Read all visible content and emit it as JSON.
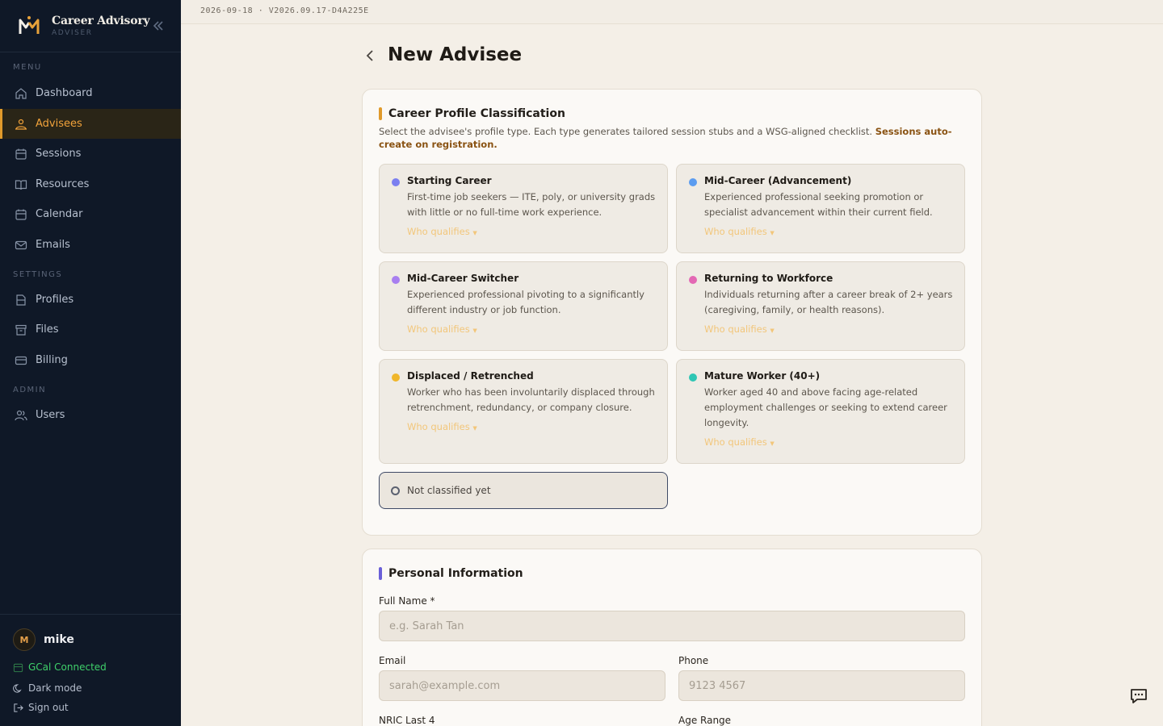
{
  "brand": {
    "title": "Career Advisory",
    "subtitle": "ADVISER"
  },
  "nav": {
    "menu_label": "MENU",
    "settings_label": "SETTINGS",
    "admin_label": "ADMIN",
    "items": [
      {
        "label": "Dashboard",
        "icon": "home-icon"
      },
      {
        "label": "Advisees",
        "icon": "users-icon",
        "active": true
      },
      {
        "label": "Sessions",
        "icon": "calendar-icon"
      },
      {
        "label": "Resources",
        "icon": "book-icon"
      },
      {
        "label": "Calendar",
        "icon": "calendar-icon"
      },
      {
        "label": "Emails",
        "icon": "mail-icon"
      },
      {
        "label": "Profiles",
        "icon": "file-icon"
      },
      {
        "label": "Files",
        "icon": "archive-icon"
      },
      {
        "label": "Billing",
        "icon": "credit-card-icon"
      },
      {
        "label": "Users",
        "icon": "people-icon"
      }
    ]
  },
  "footer": {
    "avatar_initial": "M",
    "user_name": "mike",
    "gcal": "GCal Connected",
    "dark_mode": "Dark mode",
    "sign_out": "Sign out"
  },
  "topbar": {
    "build": "2026-09-18 · V2026.09.17-D4A225E"
  },
  "page": {
    "title": "New Advisee"
  },
  "classification": {
    "title": "Career Profile Classification",
    "description": "Select the advisee's profile type. Each type generates tailored session stubs and a WSG-aligned checklist.",
    "description_bold": "Sessions auto-create on registration.",
    "who_qualifies": "Who qualifies",
    "options": [
      {
        "title": "Starting Career",
        "desc": "First-time job seekers — ITE, poly, or university grads with little or no full-time work experience.",
        "color": "#7b7ff0"
      },
      {
        "title": "Mid-Career (Advancement)",
        "desc": "Experienced professional seeking promotion or specialist advancement within their current field.",
        "color": "#5b9cf0"
      },
      {
        "title": "Mid-Career Switcher",
        "desc": "Experienced professional pivoting to a significantly different industry or job function.",
        "color": "#a87ff0"
      },
      {
        "title": "Returning to Workforce",
        "desc": "Individuals returning after a career break of 2+ years (caregiving, family, or health reasons).",
        "color": "#e368b4"
      },
      {
        "title": "Displaced / Retrenched",
        "desc": "Worker who has been involuntarily displaced through retrenchment, redundancy, or company closure.",
        "color": "#f0b62a"
      },
      {
        "title": "Mature Worker (40+)",
        "desc": "Worker aged 40 and above facing age-related employment challenges or seeking to extend career longevity.",
        "color": "#2fc6b4"
      }
    ],
    "not_classified": "Not classified yet"
  },
  "personal": {
    "title": "Personal Information",
    "full_name_label": "Full Name *",
    "full_name_placeholder": "e.g. Sarah Tan",
    "email_label": "Email",
    "email_placeholder": "sarah@example.com",
    "phone_label": "Phone",
    "phone_placeholder": "9123 4567",
    "nric_label": "NRIC Last 4",
    "age_label": "Age Range"
  },
  "colors": {
    "accent": "#e09a2b",
    "sidebar_bg": "#0f1827",
    "page_bg": "#f4efe7",
    "personal_accent": "#6a5fd8"
  }
}
